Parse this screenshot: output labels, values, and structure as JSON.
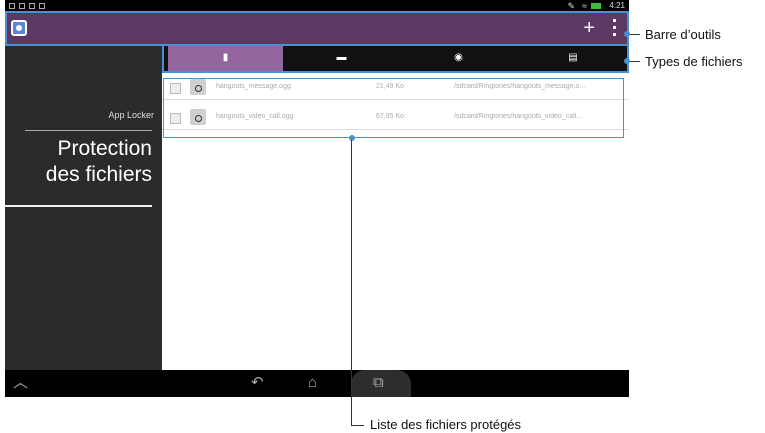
{
  "status_bar": {
    "time": "4:21"
  },
  "toolbar": {
    "add_label": "+"
  },
  "sidebar": {
    "subtitle": "App Locker",
    "title_line1": "Protection",
    "title_line2": "des fichiers"
  },
  "tabs": [
    {
      "icon": "file-icon",
      "active": true
    },
    {
      "icon": "image-icon",
      "active": false
    },
    {
      "icon": "music-icon",
      "active": false
    },
    {
      "icon": "document-icon",
      "active": false
    }
  ],
  "files": [
    {
      "name": "hangouts_message.ogg",
      "size": "21,49 Ko",
      "path": "/sdcard/Ringtones/hangouts_message.o..."
    },
    {
      "name": "hangouts_video_call.ogg",
      "size": "67,95 Ko",
      "path": "/sdcard/Ringtones/hangouts_video_call..."
    }
  ],
  "callouts": {
    "toolbar": "Barre d’outils",
    "file_types": "Types de fichiers",
    "protected_list": "Liste des fichiers protégés"
  },
  "colors": {
    "toolbar_bg": "#5a3a63",
    "active_tab": "#94659e",
    "highlight": "#4a90d4"
  }
}
